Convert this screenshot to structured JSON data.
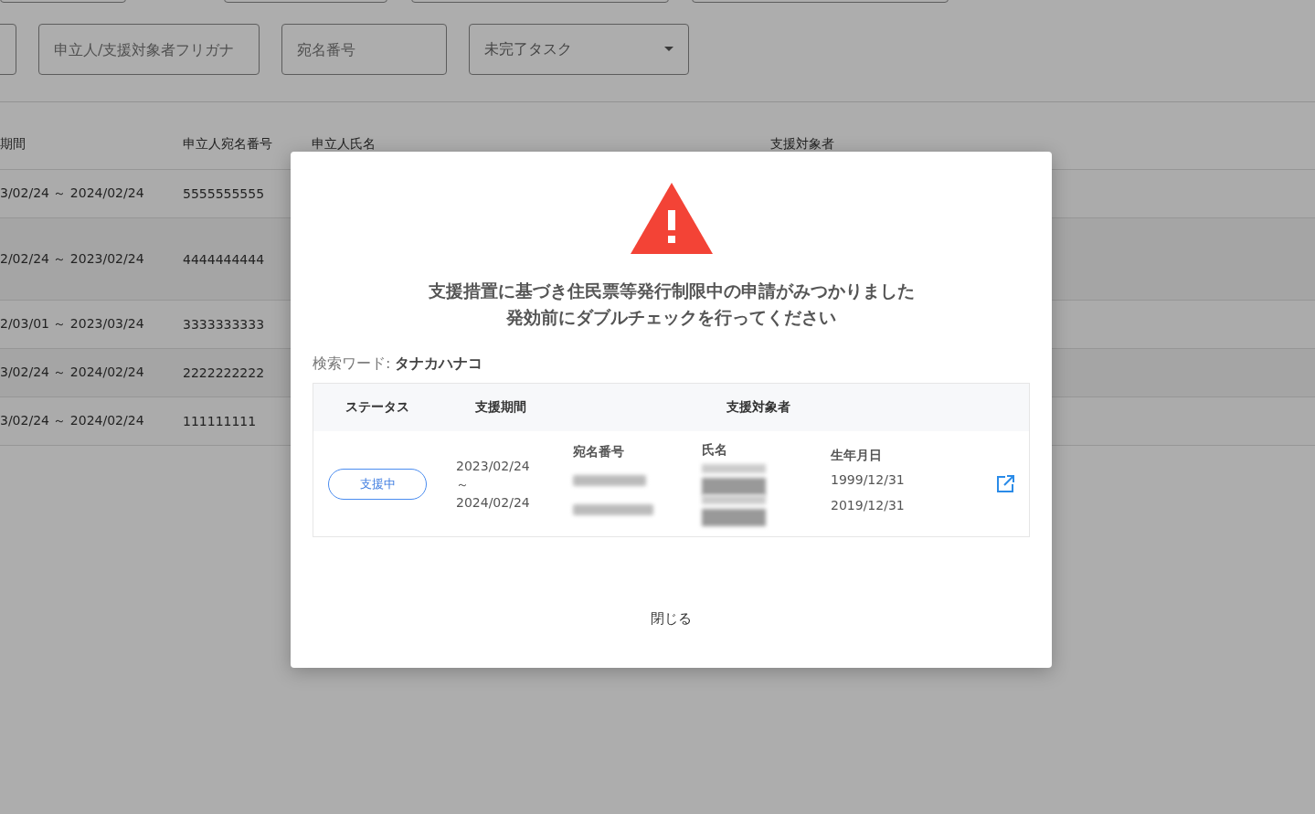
{
  "filters": {
    "fields": [
      {
        "kind": "text"
      },
      {
        "kind": "text",
        "placeholder": "申立人/支援対象者フリガナ"
      },
      {
        "kind": "text",
        "placeholder": "宛名番号"
      },
      {
        "kind": "select",
        "value": "未完了タスク"
      }
    ]
  },
  "table": {
    "columns": [
      "期間",
      "申立人宛名番号",
      "申立人氏名",
      "支援対象者"
    ],
    "rows": [
      {
        "period": "3/02/24 ～ 2024/02/24",
        "number": "5555555555"
      },
      {
        "period": "2/02/24 ～ 2023/02/24",
        "number": "4444444444"
      },
      {
        "period": "2/03/01 ～ 2023/03/24",
        "number": "3333333333"
      },
      {
        "period": "3/02/24 ～ 2024/02/24",
        "number": "2222222222"
      },
      {
        "period": "3/02/24 ～ 2024/02/24",
        "number": "111111111"
      }
    ]
  },
  "dialog": {
    "message": [
      "支援措置に基づき住民票等発行制限中の申請がみつかりました",
      "発効前にダブルチェックを行ってください"
    ],
    "search_word": "検索ワード: **タナカハナコ**",
    "columns": [
      "ステータス",
      "支援期間",
      "支援対象者"
    ],
    "result": {
      "status": "支援中",
      "period_start": "2023/02/24",
      "period_sep": "～",
      "period_end": "2024/02/24",
      "sub_columns": [
        "宛名番号",
        "氏名",
        "生年月日"
      ],
      "targets": [
        {
          "birth_date": "1999/12/31"
        },
        {
          "birth_date": "2019/12/31"
        }
      ]
    },
    "close": "閉じる"
  }
}
